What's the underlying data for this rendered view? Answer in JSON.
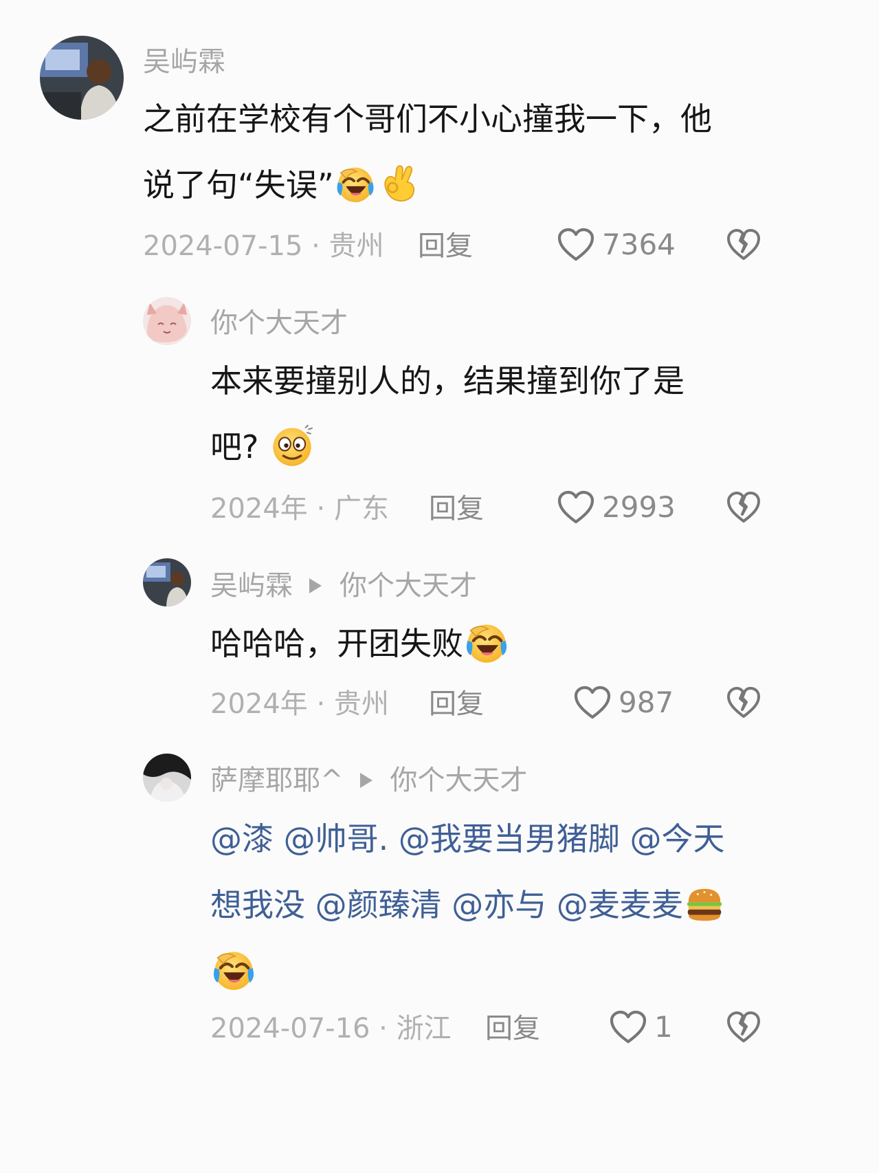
{
  "comments": [
    {
      "user": "吴屿霖",
      "text_parts": [
        "之前在学校有个哥们不小心撞我一下，他",
        "说了句“失误”"
      ],
      "date": "2024-07-15 · 贵州",
      "reply_label": "回复",
      "likes": "7364",
      "emojis": [
        "rolling-laugh-emoji",
        "ok-hand-emoji"
      ]
    },
    {
      "user": "你个大天才",
      "text_parts": [
        "本来要撞别人的，结果撞到你了是",
        "吧?"
      ],
      "date": "2024年 · 广东",
      "reply_label": "回复",
      "likes": "2993",
      "emojis": [
        "dizzy-smile-emoji"
      ]
    },
    {
      "user": "吴屿霖",
      "reply_to": "你个大天才",
      "text": "哈哈哈，开团失败",
      "date": "2024年 · 贵州",
      "reply_label": "回复",
      "likes": "987",
      "emojis": [
        "rolling-laugh-emoji"
      ]
    },
    {
      "user": "萨摩耶耶^",
      "reply_to": "你个大天才",
      "text_parts": [
        "@漆 @帅哥. @我要当男猪脚 @今天",
        "想我没 @颜臻清 @亦与 @麦麦麦"
      ],
      "date": "2024-07-16 · 浙江",
      "reply_label": "回复",
      "likes": "1",
      "emojis": [
        "hamburger-emoji",
        "rolling-laugh-emoji"
      ]
    }
  ],
  "colors": {
    "background": "#fbfbfb",
    "username": "#a6a6a6",
    "body_text": "#161616",
    "mention": "#3f5f95",
    "meta": "#b0b0b0"
  }
}
